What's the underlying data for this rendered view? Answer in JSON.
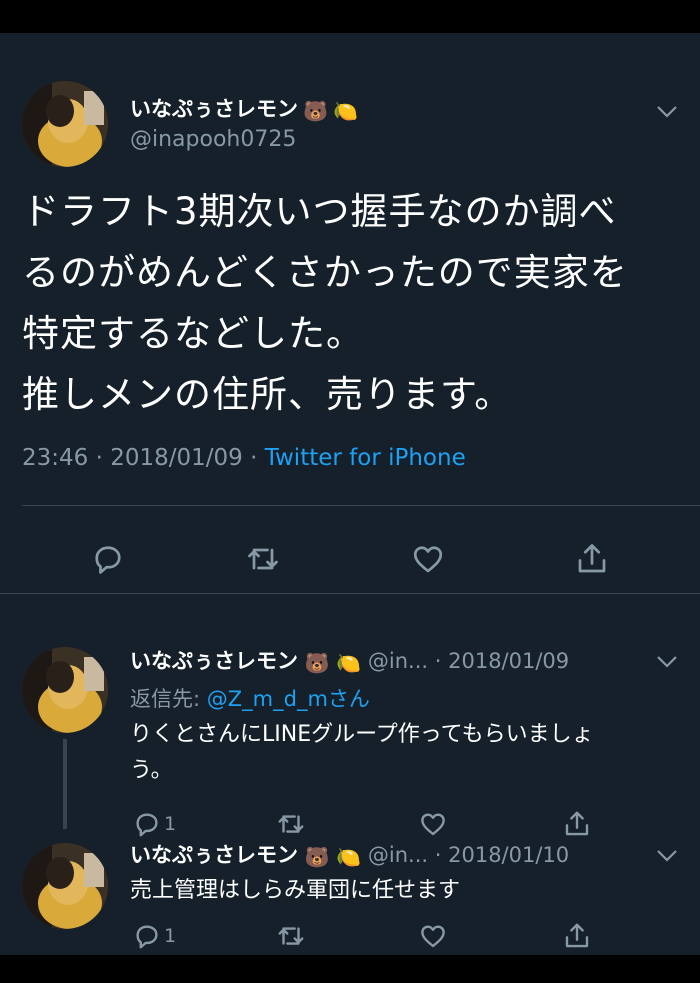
{
  "main_tweet": {
    "display_name": "いなぷぅさレモン",
    "handle": "@inapooh0725",
    "text_lines": [
      "ドラフト3期次いつ握手なのか調べ",
      "るのがめんどくさかったので実家を",
      "特定するなどした。",
      "推しメンの住所、売ります。"
    ],
    "time": "23:46",
    "date": "2018/01/09",
    "source": "Twitter for iPhone",
    "emoji": [
      "🐻",
      "🍋"
    ]
  },
  "replies": [
    {
      "display_name": "いなぷぅさレモン",
      "handle_truncated": "@in...",
      "date": "2018/01/09",
      "reply_to_label": "返信先:",
      "reply_to_mention": "@Z_m_d_mさん",
      "text_lines": [
        "りくとさんにLINEグループ作ってもらいましょ",
        "う。"
      ],
      "reply_count": "1"
    },
    {
      "display_name": "いなぷぅさレモン",
      "handle_truncated": "@in...",
      "date": "2018/01/10",
      "text_lines": [
        "売上管理はしらみ軍団に任せます"
      ],
      "reply_count": "1"
    }
  ],
  "separator": "·",
  "colors": {
    "background": "#15202b",
    "text": "#ffffff",
    "secondary": "#8899a6",
    "accent": "#1da1f2",
    "divider": "#38444d"
  },
  "icons": [
    "reply-icon",
    "retweet-icon",
    "like-icon",
    "share-icon",
    "chevron-down-icon"
  ]
}
